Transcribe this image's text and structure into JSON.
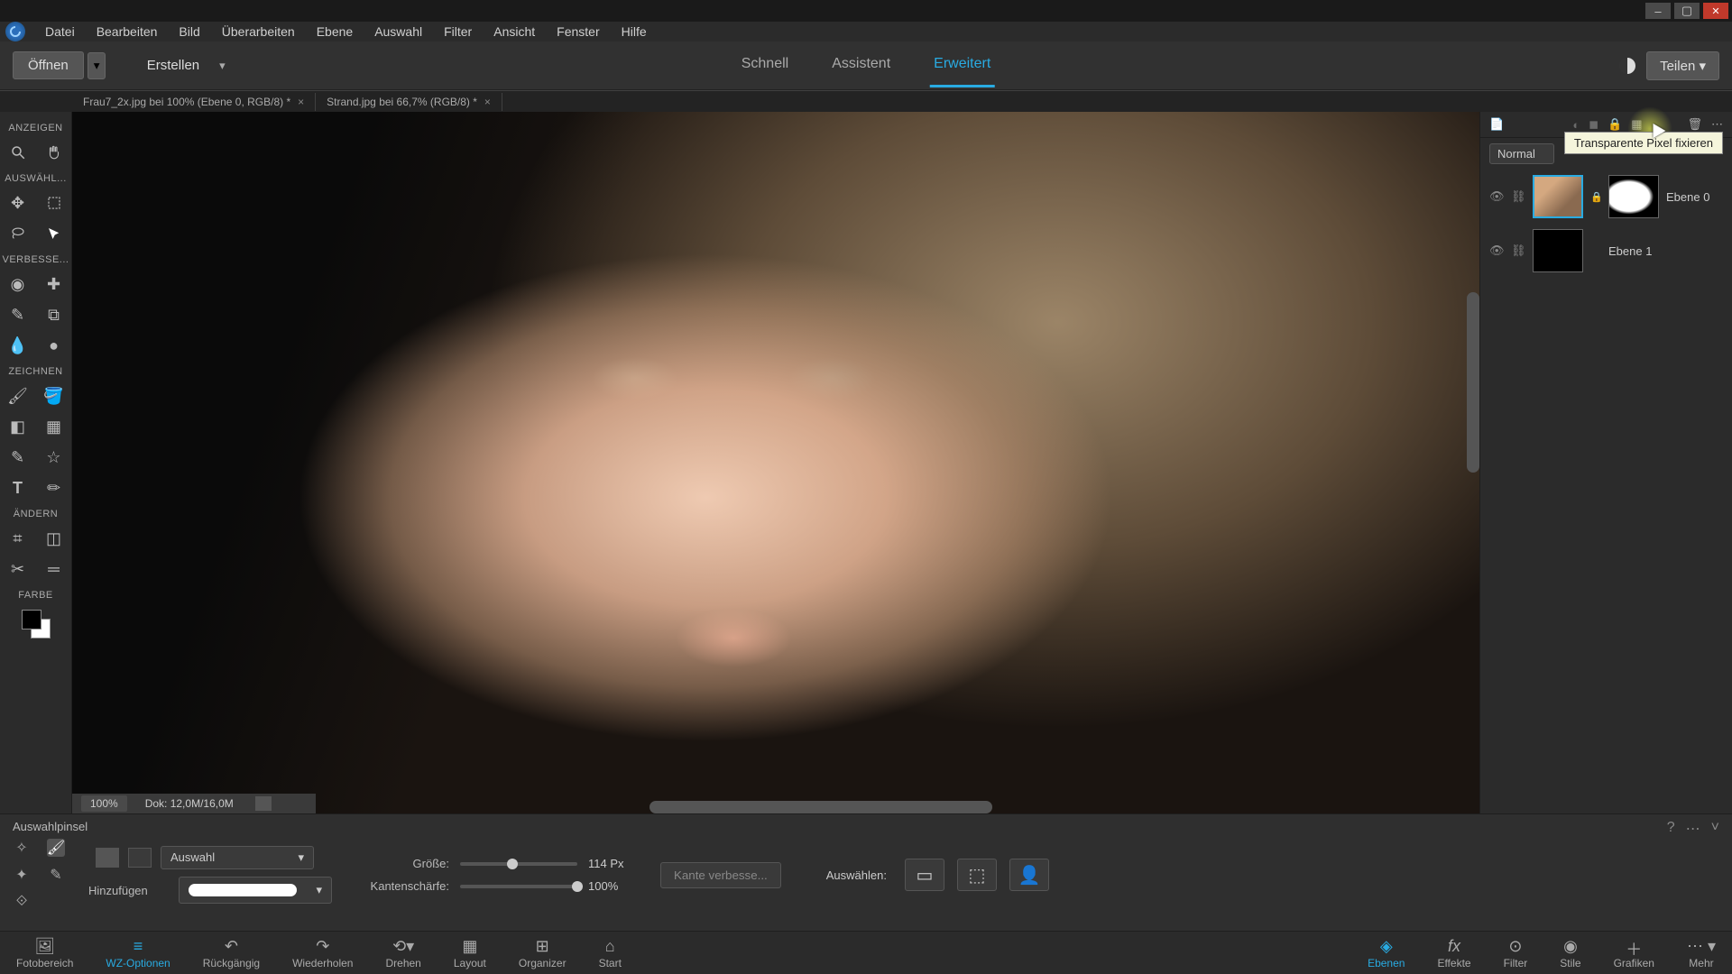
{
  "window": {
    "minimize": "–",
    "maximize": "▢",
    "close": "✕"
  },
  "menu": {
    "items": [
      "Datei",
      "Bearbeiten",
      "Bild",
      "Überarbeiten",
      "Ebene",
      "Auswahl",
      "Filter",
      "Ansicht",
      "Fenster",
      "Hilfe"
    ]
  },
  "topbar": {
    "open_label": "Öffnen",
    "create_label": "Erstellen",
    "tabs": [
      "Schnell",
      "Assistent",
      "Erweitert"
    ],
    "active_tab": "Erweitert",
    "share_label": "Teilen"
  },
  "documents": {
    "tabs": [
      {
        "label": "Frau7_2x.jpg bei 100% (Ebene 0, RGB/8) *"
      },
      {
        "label": "Strand.jpg bei 66,7% (RGB/8) *"
      }
    ]
  },
  "left_toolbar": {
    "sections": {
      "anzeigen": "ANZEIGEN",
      "auswahl": "AUSWÄHL...",
      "verbessern": "VERBESSE...",
      "zeichnen": "ZEICHNEN",
      "aendern": "ÄNDERN",
      "farbe": "FARBE"
    }
  },
  "canvas": {
    "zoom": "100%",
    "doc_stats": "Dok: 12,0M/16,0M"
  },
  "right_panel": {
    "tooltip": "Transparente Pixel fixieren",
    "blend_mode": "Normal",
    "layers": [
      {
        "name": "Ebene 0",
        "has_mask": true,
        "locked": true,
        "active": true
      },
      {
        "name": "Ebene 1",
        "has_mask": false,
        "locked": false,
        "active": false
      }
    ]
  },
  "options": {
    "tool_name": "Auswahlpinsel",
    "mode_dropdown": "Auswahl",
    "addmode_label": "Hinzufügen",
    "size_label": "Größe:",
    "size_value": "114 Px",
    "size_pct": 40,
    "hardness_label": "Kantenschärfe:",
    "hardness_value": "100%",
    "hardness_pct": 100,
    "refine_edge": "Kante verbesse...",
    "select_label": "Auswählen:"
  },
  "bottombar": {
    "left": [
      {
        "label": "Fotobereich",
        "icon": "image-stack-icon"
      },
      {
        "label": "WZ-Optionen",
        "icon": "sliders-icon",
        "active": true
      },
      {
        "label": "Rückgängig",
        "icon": "undo-icon"
      },
      {
        "label": "Wiederholen",
        "icon": "redo-icon"
      },
      {
        "label": "Drehen",
        "icon": "rotate-icon"
      },
      {
        "label": "Layout",
        "icon": "layout-icon"
      },
      {
        "label": "Organizer",
        "icon": "organizer-icon"
      },
      {
        "label": "Start",
        "icon": "home-icon"
      }
    ],
    "right": [
      {
        "label": "Ebenen",
        "icon": "layers-icon",
        "active": true
      },
      {
        "label": "Effekte",
        "icon": "fx-icon"
      },
      {
        "label": "Filter",
        "icon": "filter-icon"
      },
      {
        "label": "Stile",
        "icon": "styles-icon"
      },
      {
        "label": "Grafiken",
        "icon": "plus-icon"
      },
      {
        "label": "Mehr",
        "icon": "more-icon"
      }
    ]
  }
}
